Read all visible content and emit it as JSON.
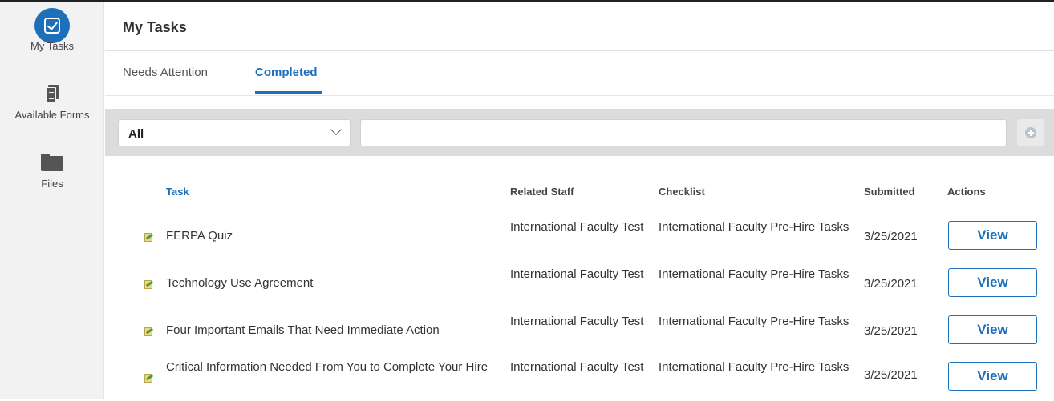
{
  "sidebar": {
    "items": [
      {
        "label": "My Tasks",
        "icon": "checkbox-icon"
      },
      {
        "label": "Available Forms",
        "icon": "document-icon"
      },
      {
        "label": "Files",
        "icon": "folder-icon"
      }
    ]
  },
  "header": {
    "title": "My Tasks"
  },
  "tabs": [
    {
      "label": "Needs Attention",
      "active": false
    },
    {
      "label": "Completed",
      "active": true
    }
  ],
  "filter": {
    "selected": "All",
    "search_value": ""
  },
  "table": {
    "headers": {
      "task": "Task",
      "staff": "Related Staff",
      "checklist": "Checklist",
      "submitted": "Submitted",
      "actions": "Actions"
    },
    "rows": [
      {
        "task": "FERPA Quiz",
        "staff": "International Faculty Test",
        "checklist": "International Faculty Pre-Hire Tasks",
        "submitted": "3/25/2021",
        "action": "View"
      },
      {
        "task": "Technology Use Agreement",
        "staff": "International Faculty Test",
        "checklist": "International Faculty Pre-Hire Tasks",
        "submitted": "3/25/2021",
        "action": "View"
      },
      {
        "task": "Four Important Emails That Need Immediate Action",
        "staff": "International Faculty Test",
        "checklist": "International Faculty Pre-Hire Tasks",
        "submitted": "3/25/2021",
        "action": "View"
      },
      {
        "task": "Critical Information Needed From You to Complete Your Hire",
        "staff": "International Faculty Test",
        "checklist": "International Faculty Pre-Hire Tasks",
        "submitted": "3/25/2021",
        "action": "View"
      }
    ]
  },
  "colors": {
    "accent": "#1c6fb8",
    "sidebar_bg": "#f2f2f2",
    "filter_bg": "#dcdcdc"
  }
}
